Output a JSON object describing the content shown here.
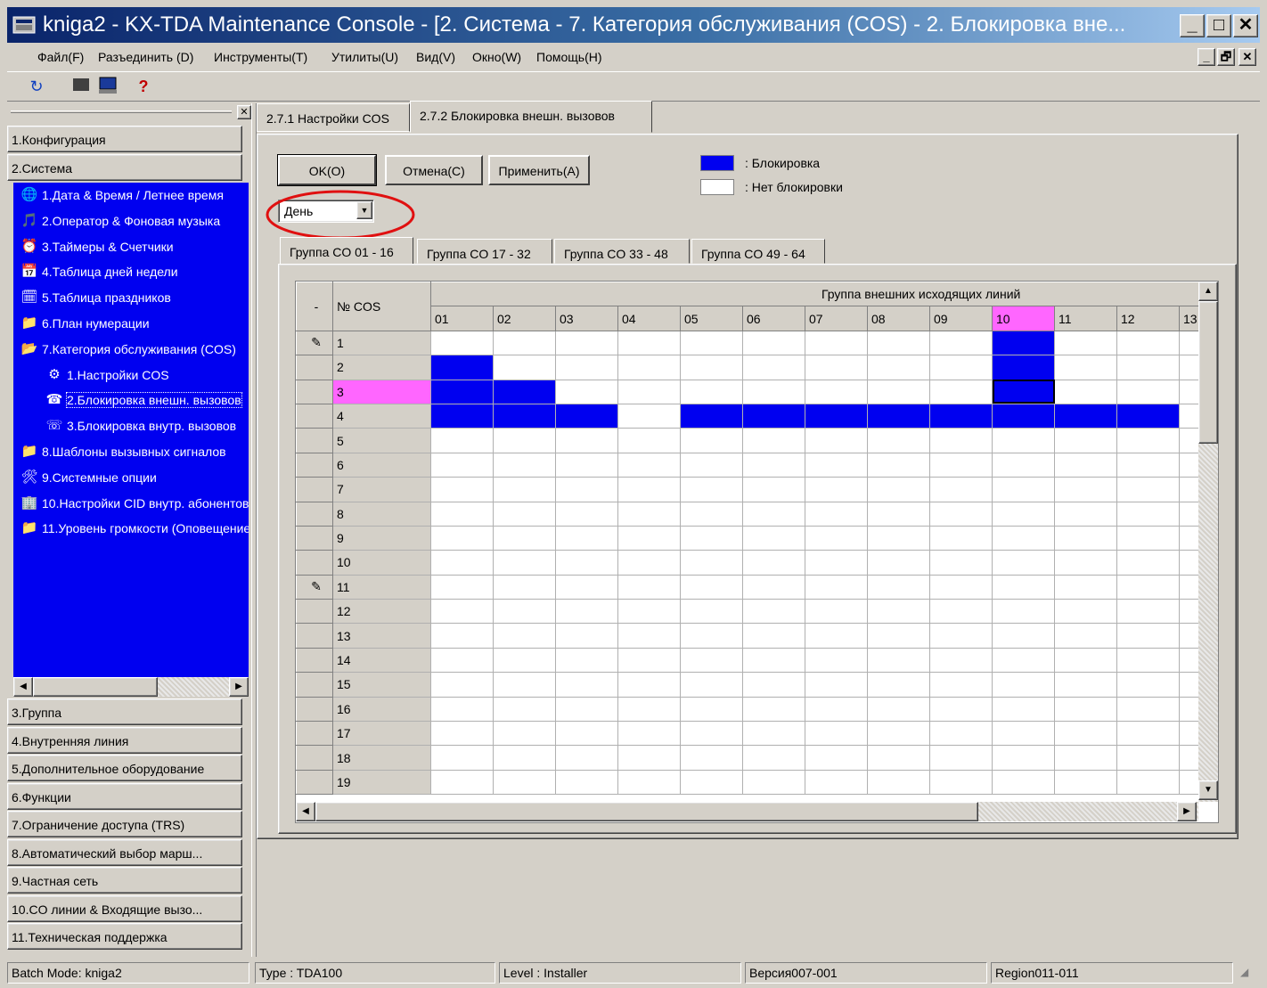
{
  "window": {
    "title": "kniga2 - KX-TDA Maintenance Console - [2. Система - 7. Категория обслуживания (COS) - 2. Блокировка вне...",
    "minimize": "_",
    "maximize": "□",
    "close": "✕"
  },
  "menu": [
    "Файл(F)",
    "Разъединить (D)",
    "Инструменты(T)",
    "Утилиты(U)",
    "Вид(V)",
    "Окно(W)",
    "Помощь(H)"
  ],
  "mdi_controls": [
    "_",
    "🗗",
    "✕"
  ],
  "toolbar_icons": [
    "refresh-icon",
    "disconnect-icon",
    "terminal-icon",
    "help-icon"
  ],
  "nav": {
    "close": "✕",
    "sections_top": [
      "1.Конфигурация",
      "2.Система"
    ],
    "tree": [
      {
        "label": "1.Дата & Время / Летнее время",
        "icon": "🌐",
        "indent": 0
      },
      {
        "label": "2.Оператор & Фоновая музыка",
        "icon": "🎵",
        "indent": 0
      },
      {
        "label": "3.Таймеры & Счетчики",
        "icon": "⏰",
        "indent": 0
      },
      {
        "label": "4.Таблица дней недели",
        "icon": "📅",
        "indent": 0
      },
      {
        "label": "5.Таблица праздников",
        "icon": "🗓",
        "indent": 0
      },
      {
        "label": "6.План нумерации",
        "icon": "📁",
        "indent": 0
      },
      {
        "label": "7.Категория обслуживания (COS)",
        "icon": "📂",
        "indent": 0
      },
      {
        "label": "1.Настройки COS",
        "icon": "⚙",
        "indent": 1
      },
      {
        "label": "2.Блокировка внешн. вызовов",
        "icon": "☎",
        "indent": 1
      },
      {
        "label": "3.Блокировка внутр. вызовов",
        "icon": "☏",
        "indent": 1
      },
      {
        "label": "8.Шаблоны вызывных сигналов",
        "icon": "📁",
        "indent": 0
      },
      {
        "label": "9.Системные опции",
        "icon": "🛠",
        "indent": 0
      },
      {
        "label": "10.Настройки CID внутр. абонентов",
        "icon": "🏢",
        "indent": 0
      },
      {
        "label": "11.Уровень громкости (Оповещение)",
        "icon": "📁",
        "indent": 0
      }
    ],
    "sections_bottom": [
      "3.Группа",
      "4.Внутренняя линия",
      "5.Дополнительное оборудование",
      "6.Функции",
      "7.Ограничение доступа (TRS)",
      "8.Автоматический выбор марш...",
      "9.Частная сеть",
      "10.CO линии & Входящие вызо...",
      "11.Техническая поддержка"
    ]
  },
  "tabs": [
    "2.7.1 Настройки COS",
    "2.7.2 Блокировка внешн. вызовов"
  ],
  "buttons": {
    "ok": "OK(O)",
    "cancel": "Отмена(C)",
    "apply": "Применить(A)"
  },
  "legend": {
    "blocked": ": Блокировка",
    "not_blocked": ": Нет блокировки",
    "blocked_color": "#0000f0",
    "not_blocked_color": "#ffffff"
  },
  "mode_select": {
    "value": "День"
  },
  "group_tabs": [
    "Группа CO 01 - 16",
    "Группа CO 17 - 32",
    "Группа CO 33 - 48",
    "Группа CO 49 - 64"
  ],
  "grid": {
    "corner": "-",
    "cos_header": "№ COS",
    "group_header": "Группа внешних исходящих линий",
    "columns": [
      "01",
      "02",
      "03",
      "04",
      "05",
      "06",
      "07",
      "08",
      "09",
      "10",
      "11",
      "12",
      "13"
    ],
    "selected_column": "10",
    "selected_row": "3",
    "rows": [
      {
        "cos": "1",
        "icon": true,
        "blocked": [
          "10"
        ]
      },
      {
        "cos": "2",
        "icon": false,
        "blocked": [
          "01",
          "10"
        ]
      },
      {
        "cos": "3",
        "icon": false,
        "blocked": [
          "01",
          "02",
          "10"
        ]
      },
      {
        "cos": "4",
        "icon": false,
        "blocked": [
          "01",
          "02",
          "03",
          "05",
          "06",
          "07",
          "08",
          "09",
          "10",
          "11",
          "12"
        ]
      },
      {
        "cos": "5",
        "icon": false,
        "blocked": []
      },
      {
        "cos": "6",
        "icon": false,
        "blocked": []
      },
      {
        "cos": "7",
        "icon": false,
        "blocked": []
      },
      {
        "cos": "8",
        "icon": false,
        "blocked": []
      },
      {
        "cos": "9",
        "icon": false,
        "blocked": []
      },
      {
        "cos": "10",
        "icon": false,
        "blocked": []
      },
      {
        "cos": "11",
        "icon": true,
        "blocked": []
      },
      {
        "cos": "12",
        "icon": false,
        "blocked": []
      },
      {
        "cos": "13",
        "icon": false,
        "blocked": []
      },
      {
        "cos": "14",
        "icon": false,
        "blocked": []
      },
      {
        "cos": "15",
        "icon": false,
        "blocked": []
      },
      {
        "cos": "16",
        "icon": false,
        "blocked": []
      },
      {
        "cos": "17",
        "icon": false,
        "blocked": []
      },
      {
        "cos": "18",
        "icon": false,
        "blocked": []
      },
      {
        "cos": "19",
        "icon": false,
        "blocked": []
      }
    ]
  },
  "status": [
    "Batch Mode: kniga2",
    "Type : TDA100",
    "Level : Installer",
    "Версия007-001",
    "Region011-011"
  ]
}
